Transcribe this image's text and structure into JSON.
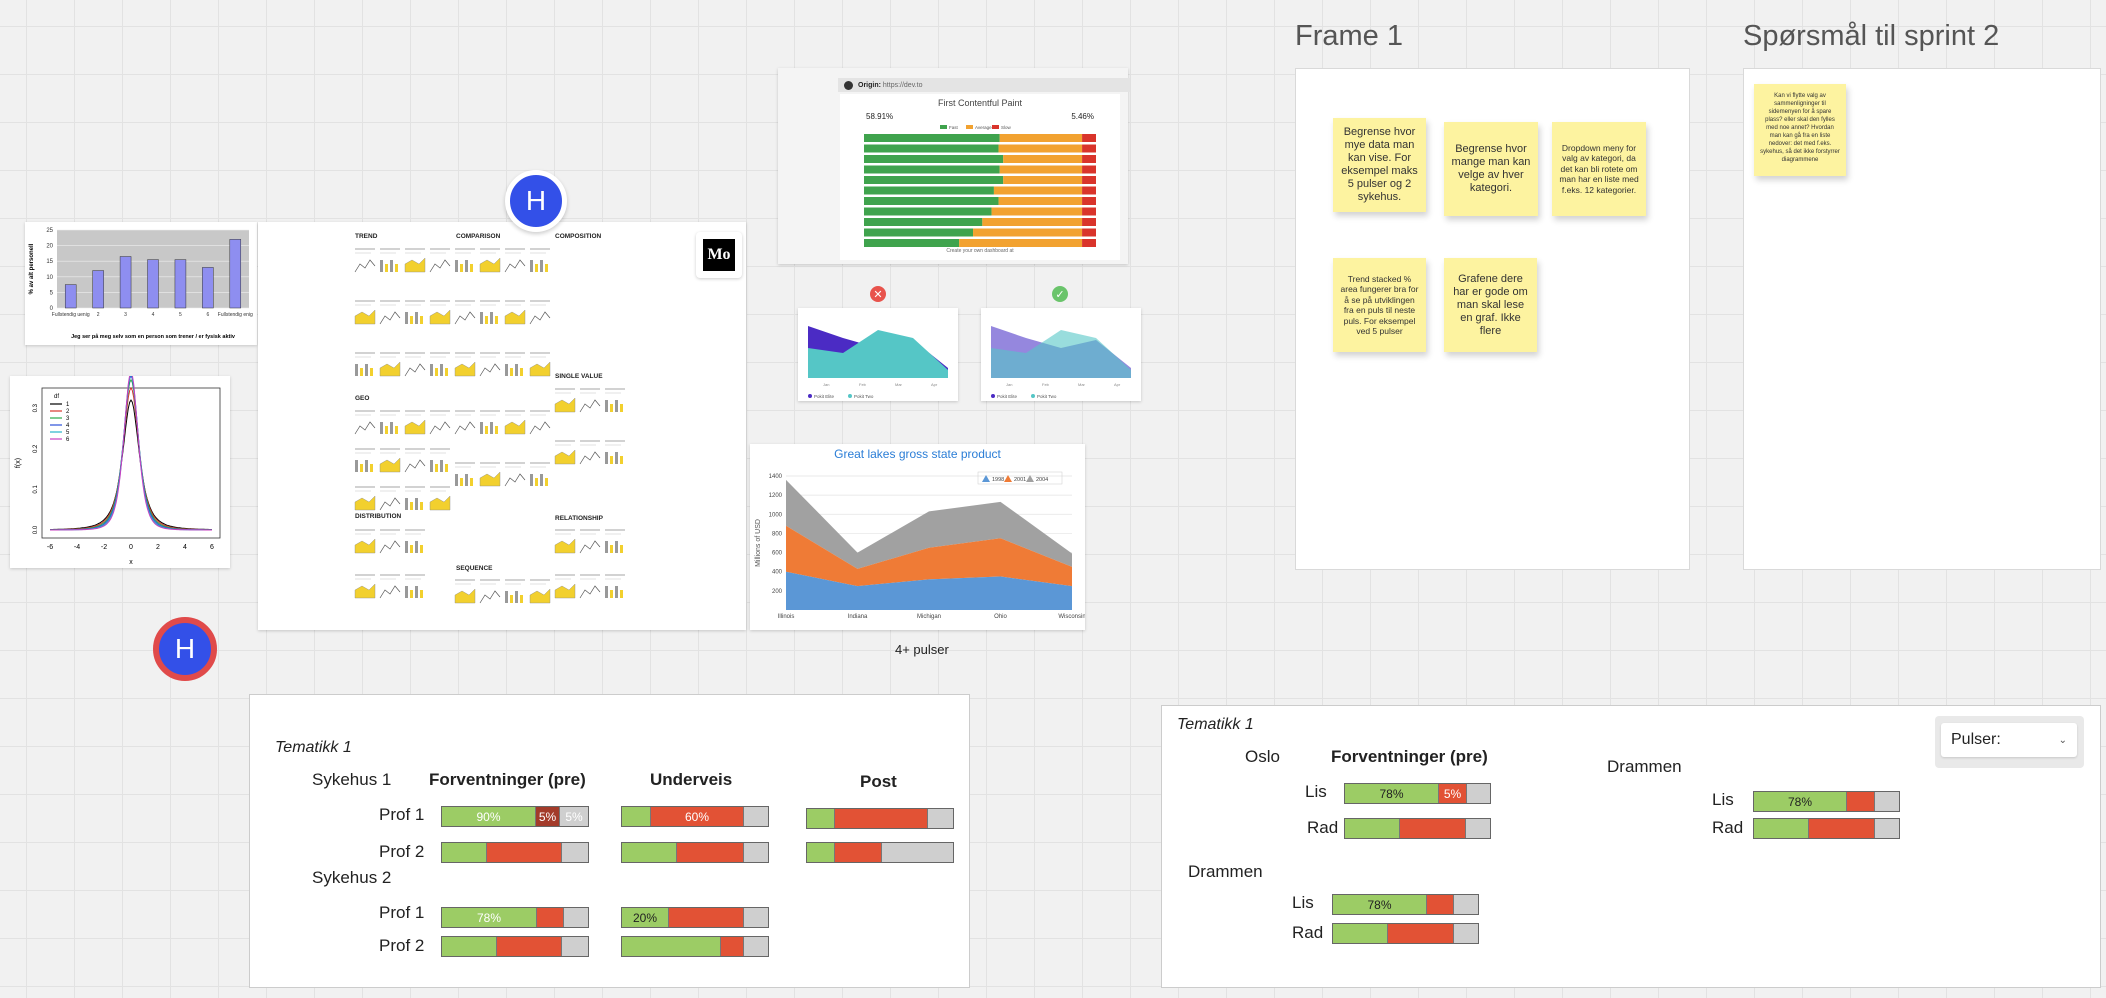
{
  "frames": {
    "frame1_title": "Frame 1",
    "frame2_title": "Spørsmål til sprint 2"
  },
  "stickies": {
    "s1": "Begrense hvor mye data man kan vise. For eksempel maks 5 pulser og 2 sykehus.",
    "s2": "Begrense hvor mange man kan velge av hver kategori.",
    "s3": "Dropdown meny for valg av kategori, da det kan bli rotete om man har en liste med f.eks. 12 kategorier.",
    "s4": "Trend stacked % area fungerer bra for å se på utviklingen fra en puls til neste puls. For eksempel ved 5 pulser",
    "s5": "Grafene dere har er gode om man skal lese en graf. Ikke flere",
    "s6": "Kan vi flytte valg av sammenligninger til sidemenyen for å spare plass? eller skal den fylles med noe annet? Hvordan man kan gå fra en liste nedover: det med f.eks. sykehus, så det ikke forstyrrer diagrammene"
  },
  "avatars": {
    "a1": "H",
    "a2": "H"
  },
  "bar_chart": {
    "ylabel": "% av alt personell",
    "xlabel": "Jeg ser på meg selv som en person som trener / er fysisk aktiv",
    "categories": [
      "Fullstendig uenig",
      "2",
      "3",
      "4",
      "5",
      "6",
      "Fullstendig enig"
    ],
    "values": [
      7.5,
      12,
      16.5,
      15.5,
      15.5,
      13,
      22
    ],
    "ylim": [
      0,
      25
    ],
    "yticks": [
      "0",
      "5",
      "10",
      "15",
      "20",
      "25"
    ]
  },
  "density_plot": {
    "ylabel": "f(x)",
    "xlabel": "x",
    "xticks": [
      "-6",
      "-4",
      "-2",
      "0",
      "2",
      "4",
      "6"
    ],
    "yticks": [
      "0.0",
      "0.1",
      "0.2",
      "0.3"
    ],
    "legend_title": "df",
    "legend": [
      "1",
      "2",
      "3",
      "4",
      "5",
      "6"
    ],
    "colors": [
      "#000000",
      "#d9342b",
      "#2aa84a",
      "#2b4fd9",
      "#27b4c9",
      "#c83fc2"
    ]
  },
  "poster": {
    "sections": [
      "TREND",
      "COMPARISON",
      "COMPOSITION",
      "GEO",
      "SINGLE VALUE",
      "DISTRIBUTION",
      "RELATIONSHIP",
      "SEQUENCE"
    ],
    "badge": "Mo"
  },
  "fcp": {
    "origin_label": "Origin:",
    "origin_url": "https://dev.to",
    "title": "First Contentful Paint",
    "left_pct": "58.91%",
    "right_pct": "5.46%",
    "legend": [
      "Fast",
      "Average",
      "Slow"
    ],
    "rows": [
      0.585,
      0.58,
      0.6,
      0.585,
      0.6,
      0.56,
      0.58,
      0.55,
      0.51,
      0.47,
      0.41
    ],
    "footer": "Create your own dashboard at"
  },
  "area_compare": {
    "bad_icon": "✕",
    "good_icon": "✓",
    "legend": [
      "Pokit Elite",
      "Pokit Two"
    ]
  },
  "great_lakes": {
    "title": "Great lakes gross state product",
    "ylabel": "Millions of USD",
    "yticks": [
      "200",
      "400",
      "600",
      "800",
      "1000",
      "1200",
      "1400"
    ],
    "categories": [
      "Illinois",
      "Indiana",
      "Michigan",
      "Ohio",
      "Wisconsin"
    ],
    "legend": [
      "1998",
      "2001",
      "2004"
    ],
    "caption": "4+ pulser"
  },
  "chart_data": {
    "type": "area",
    "title": "Great lakes gross state product",
    "ylabel": "Millions of USD",
    "categories": [
      "Illinois",
      "Indiana",
      "Michigan",
      "Ohio",
      "Wisconsin"
    ],
    "ylim": [
      0,
      1400
    ],
    "series": [
      {
        "name": "1998",
        "values": [
          400,
          250,
          320,
          350,
          250
        ]
      },
      {
        "name": "2001",
        "values": [
          480,
          180,
          330,
          400,
          200
        ]
      },
      {
        "name": "2004",
        "values": [
          480,
          170,
          380,
          380,
          140
        ]
      }
    ]
  },
  "table1": {
    "title": "Tematikk 1",
    "hospital1": "Sykehus 1",
    "hospital2": "Sykehus 2",
    "col1": "Forventninger (pre)",
    "col2": "Underveis",
    "col3": "Post",
    "prof1": "Prof 1",
    "prof2": "Prof 2",
    "v90": "90%",
    "v5a": "5%",
    "v5b": "5%",
    "v60": "60%",
    "v78": "78%",
    "v20": "20%"
  },
  "table2": {
    "title": "Tematikk 1",
    "oslo": "Oslo",
    "col1": "Forventninger (pre)",
    "drammen_r": "Drammen",
    "drammen_l": "Drammen",
    "lis": "Lis",
    "rad": "Rad",
    "v78a": "78%",
    "v5": "5%",
    "v78b": "78%",
    "v78c": "78%",
    "dropdown_label": "Pulser:"
  }
}
